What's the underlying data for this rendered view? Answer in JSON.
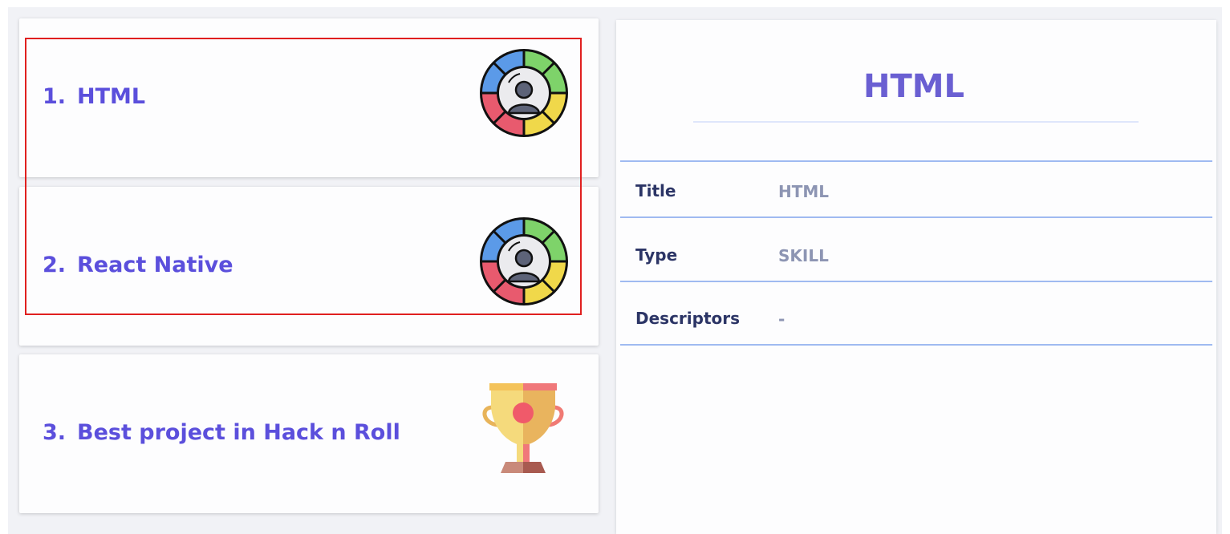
{
  "list": {
    "items": [
      {
        "number": "1.",
        "title": "HTML",
        "icon": "skill-wheel-icon"
      },
      {
        "number": "2.",
        "title": "React Native",
        "icon": "skill-wheel-icon"
      },
      {
        "number": "3.",
        "title": "Best project in Hack n Roll",
        "icon": "trophy-icon"
      }
    ]
  },
  "detail": {
    "title": "HTML",
    "properties": [
      {
        "name": "Title",
        "value": "HTML"
      },
      {
        "name": "Type",
        "value": "SKILL"
      },
      {
        "name": "Descriptors",
        "value": "-"
      }
    ]
  },
  "colors": {
    "accent": "#5b4fdc",
    "selection": "#e01f1f",
    "divider": "#9fbaf1"
  }
}
